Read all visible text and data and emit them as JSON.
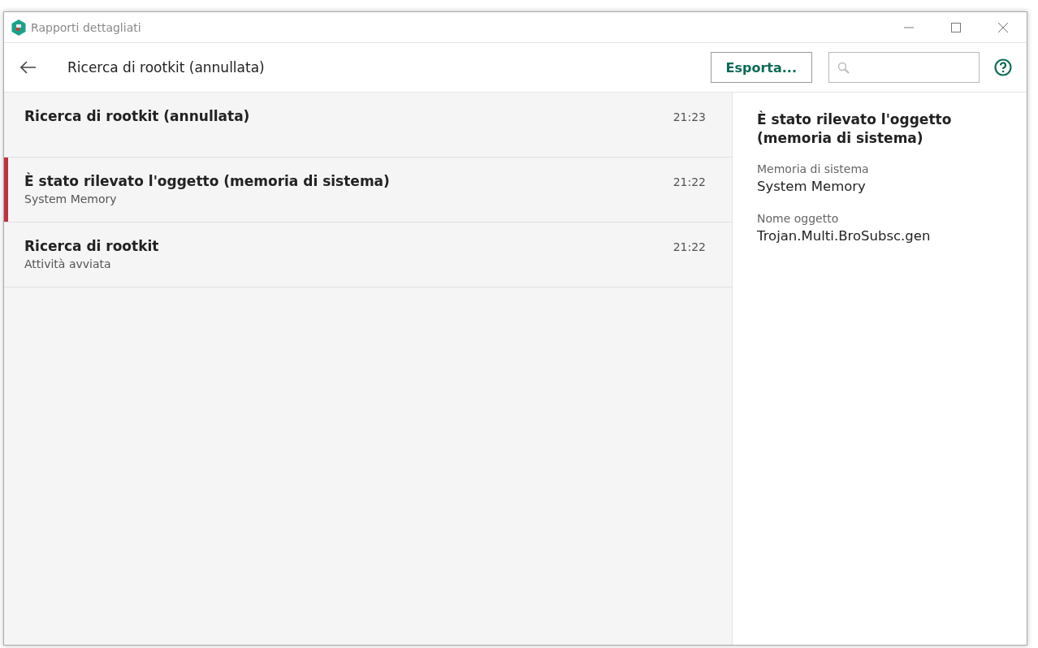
{
  "window": {
    "title": "Rapporti dettagliati"
  },
  "toolbar": {
    "title": "Ricerca di rootkit (annullata)",
    "export_button": "Esporta..."
  },
  "events": [
    {
      "title": "Ricerca di rootkit (annullata)",
      "time": "21:23",
      "selected": false
    },
    {
      "title": "È stato rilevato l'oggetto (memoria di sistema)",
      "subtitle": "System Memory",
      "time": "21:22",
      "selected": true
    },
    {
      "title": "Ricerca di rootkit",
      "subtitle": "Attività avviata",
      "time": "21:22",
      "selected": false
    }
  ],
  "details": {
    "title": "È stato rilevato l'oggetto (memoria di sistema)",
    "fields": [
      {
        "label": "Memoria di sistema",
        "value": "System Memory"
      },
      {
        "label": "Nome oggetto",
        "value": "Trojan.Multi.BroSubsc.gen"
      }
    ]
  }
}
